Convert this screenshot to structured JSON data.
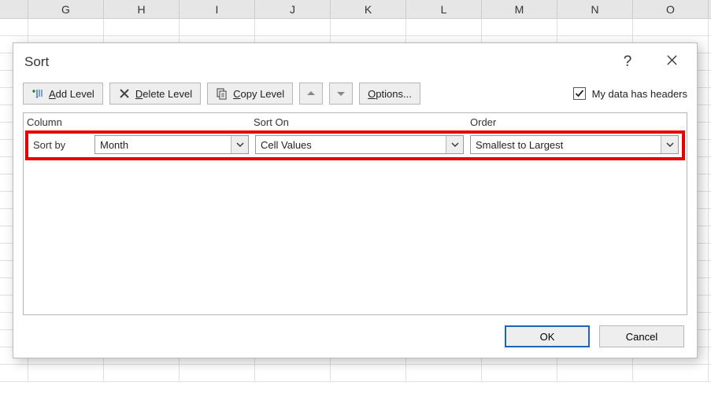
{
  "columns": [
    "",
    "G",
    "H",
    "I",
    "J",
    "K",
    "L",
    "M",
    "N",
    "O"
  ],
  "dialog": {
    "title": "Sort",
    "toolbar": {
      "add_prefix": "A",
      "add_rest": "dd Level",
      "del_prefix": "D",
      "del_rest": "elete Level",
      "copy_prefix": "C",
      "copy_rest": "opy Level",
      "options_prefix": "O",
      "options_rest": "ptions...",
      "headers_prefix": "My data has ",
      "headers_u": "h",
      "headers_rest": "eaders"
    },
    "headers": {
      "column": "Column",
      "sorton": "Sort On",
      "order": "Order"
    },
    "row": {
      "label": "Sort by",
      "column_value": "Month",
      "sorton_value": "Cell Values",
      "order_value": "Smallest to Largest"
    },
    "footer": {
      "ok": "OK",
      "cancel": "Cancel"
    }
  }
}
